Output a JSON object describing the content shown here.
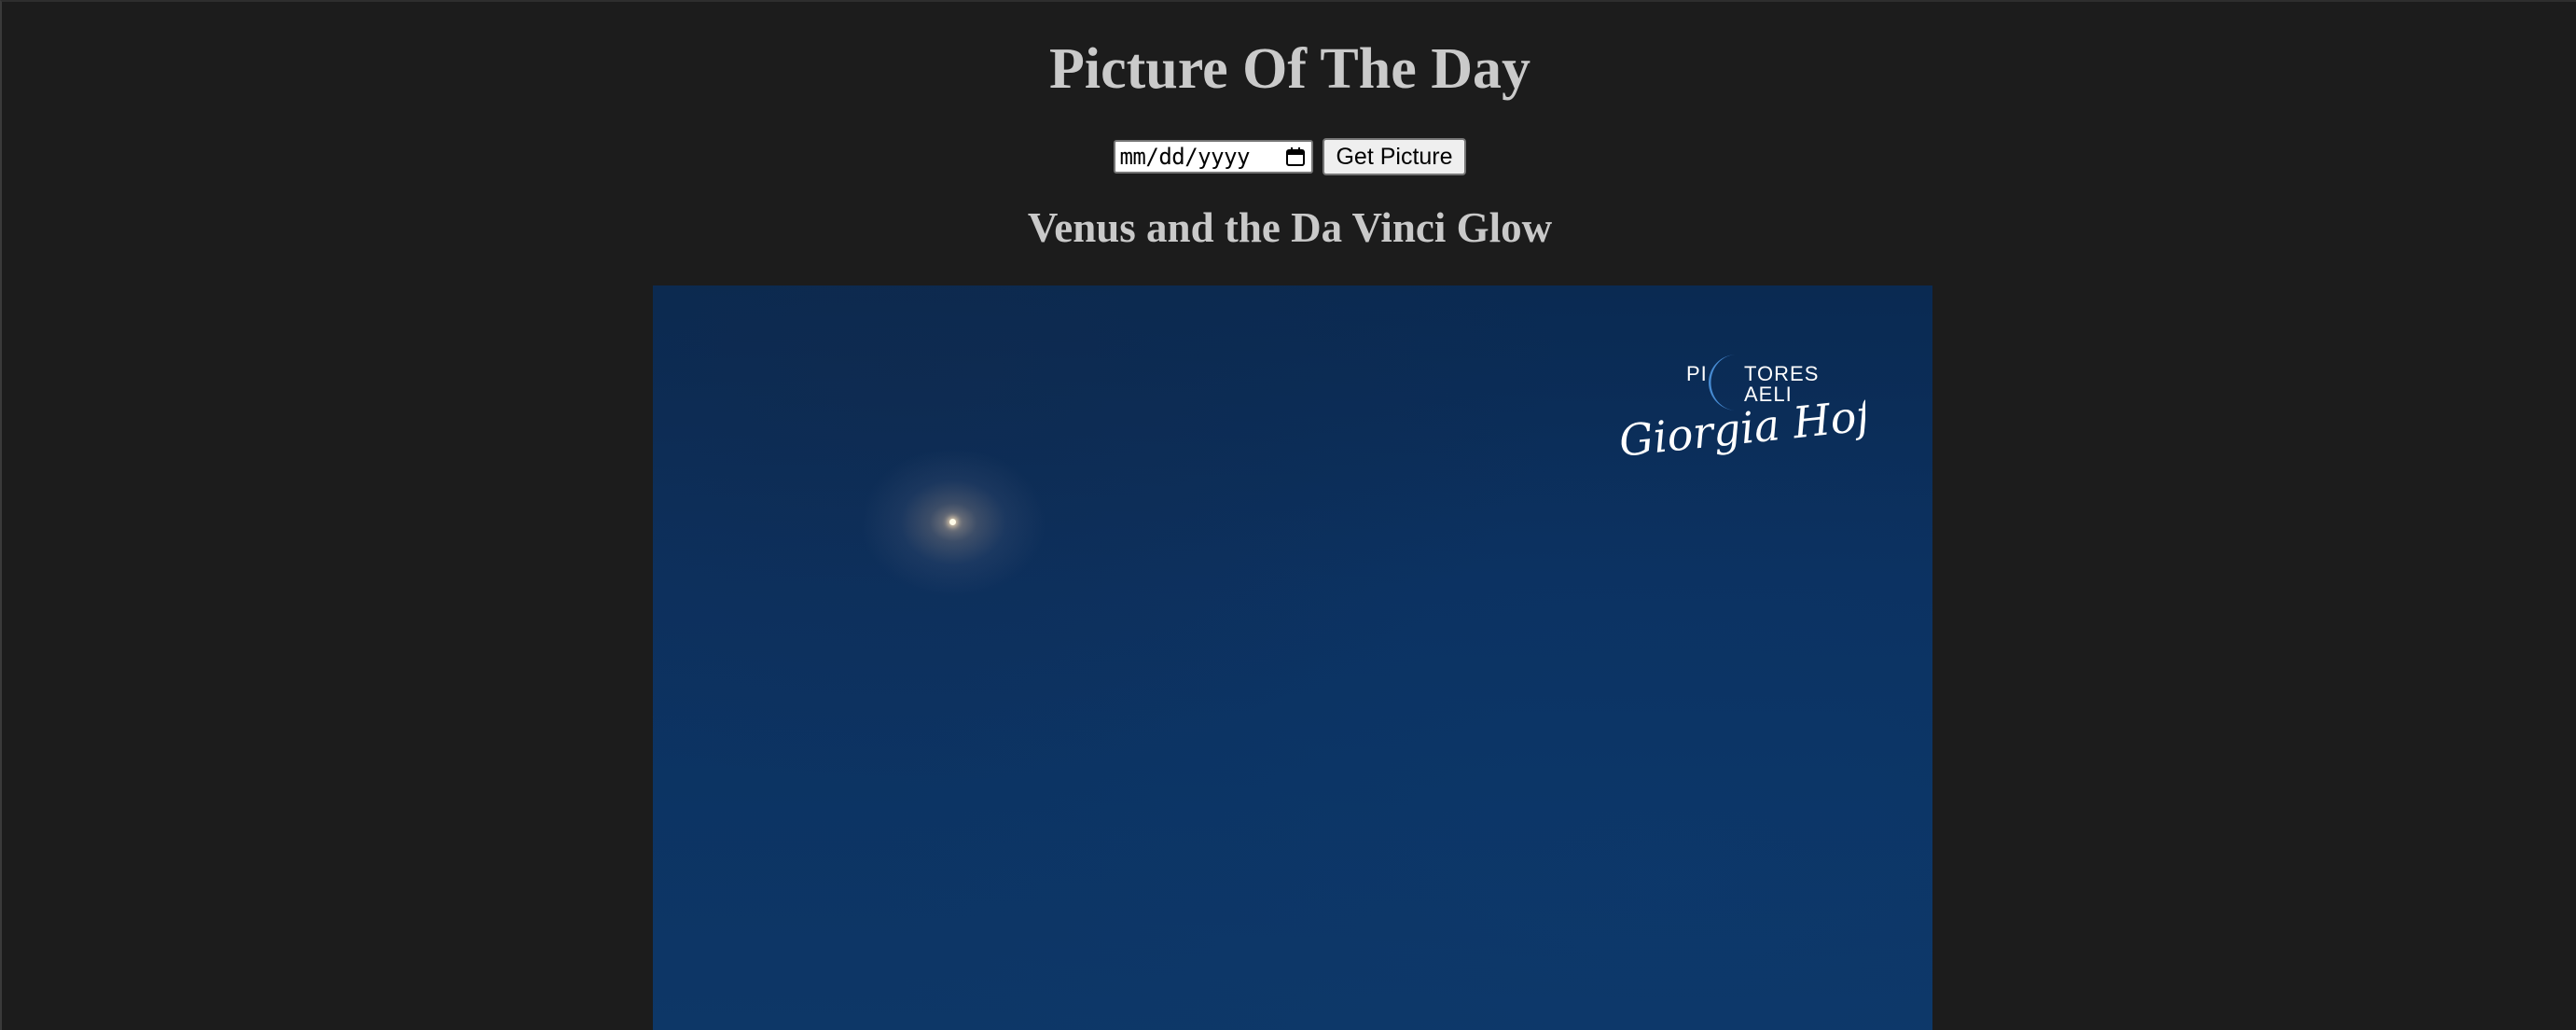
{
  "header": {
    "title": "Picture Of The Day"
  },
  "controls": {
    "date_placeholder": "mm/dd/yyyy",
    "get_button_label": "Get Picture"
  },
  "picture": {
    "title": "Venus and the Da Vinci Glow",
    "watermark_brand": "PICTORES CAELI",
    "watermark_signature": "Giorgia Hofer"
  },
  "colors": {
    "background": "#1c1c1c",
    "text": "#c9c9c9",
    "sky": "#0c3160",
    "watermark_accent": "#4a8fd8"
  },
  "icons": {
    "date_picker": "calendar-icon"
  }
}
